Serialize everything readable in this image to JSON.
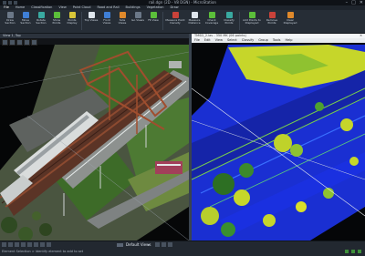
{
  "window": {
    "title": "rail.dgn (2D - V8 DGN) - MicroStation",
    "min": "–",
    "max": "□",
    "close": "✕"
  },
  "ribbon": {
    "tabs": [
      "File",
      "Home",
      "Classification",
      "View",
      "Point Cloud",
      "Road and Rail",
      "Buildings",
      "Vegetation",
      "Draw"
    ],
    "groups": [
      {
        "label": "Draw Section",
        "icon": "section-icon",
        "color": "#6b7888"
      },
      {
        "label": "Move Section",
        "icon": "move-icon",
        "color": "#3f7fd6"
      },
      {
        "label": "Rotate Section",
        "icon": "rotate-icon",
        "color": "#39a9a0"
      },
      {
        "label": "Show Points",
        "icon": "points-icon",
        "color": "#5bbf3a"
      },
      {
        "label": "Points Display",
        "icon": "display-icon",
        "color": "#d9c638"
      },
      {
        "label": "Top Views",
        "icon": "top-view-icon",
        "color": "#dfe6ee"
      },
      {
        "label": "Front Views",
        "icon": "front-view-icon",
        "color": "#3f7fd6"
      },
      {
        "label": "Side Views",
        "icon": "side-view-icon",
        "color": "#e0892b"
      },
      {
        "label": "Iso Views",
        "icon": "iso-view-icon",
        "color": "#6b7888"
      },
      {
        "label": "Fit View",
        "icon": "fit-icon",
        "color": "#5bbf3a"
      },
      {
        "label": "Measure Point Density",
        "icon": "measure-icon",
        "color": "#c9423a"
      },
      {
        "label": "Measure Distance",
        "icon": "ruler-icon",
        "color": "#dfe6ee"
      },
      {
        "label": "Check Coverage",
        "icon": "coverage-icon",
        "color": "#5bbf3a"
      },
      {
        "label": "Classify Points",
        "icon": "classify-icon",
        "color": "#39a9a0"
      },
      {
        "label": "Add Points to Displayed",
        "icon": "add-points-icon",
        "color": "#5bbf3a"
      },
      {
        "label": "Remove Points",
        "icon": "remove-points-icon",
        "color": "#c9423a"
      },
      {
        "label": "Clear Displayed",
        "icon": "clear-icon",
        "color": "#e0892b"
      }
    ]
  },
  "views": {
    "left_title": "View 1, Top",
    "right_title": "TMSD_2.las - 350 MK (06 points)",
    "right_menu": [
      "File",
      "Edit",
      "View",
      "Select",
      "Classify",
      "Group",
      "Tools",
      "Help"
    ]
  },
  "statusbar": {
    "level": "Default Views",
    "hint": "Element Selection > Identify element to add to set",
    "zoom": "1:1"
  }
}
